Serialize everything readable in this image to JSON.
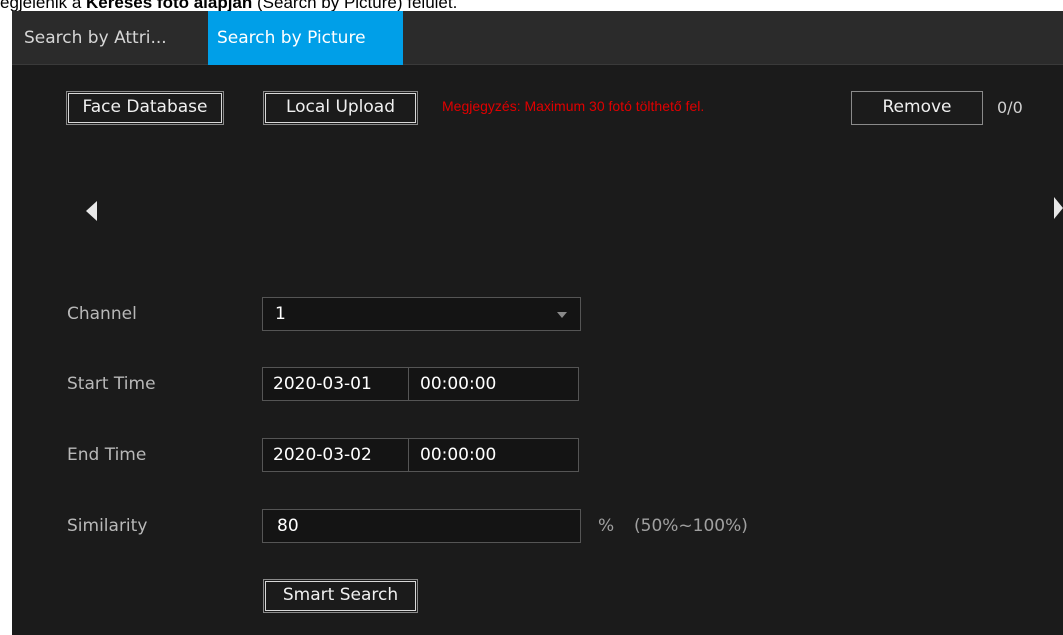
{
  "caption": {
    "prefix": "egjelenik a ",
    "bold": "Keresés fotó alapján",
    "suffix": " (Search by Picture) felület."
  },
  "tabs": [
    {
      "label": "Search by Attri...",
      "active": false
    },
    {
      "label": "Search by Picture",
      "active": true
    }
  ],
  "toolbar": {
    "face_database_label": "Face Database",
    "local_upload_label": "Local Upload",
    "note": "Megjegyzés: Maximum 30 fotó tölthető fel.",
    "remove_label": "Remove",
    "counter": "0/0"
  },
  "form": {
    "channel": {
      "label": "Channel",
      "value": "1"
    },
    "start_time": {
      "label": "Start Time",
      "date": "2020-03-01",
      "time": "00:00:00"
    },
    "end_time": {
      "label": "End Time",
      "date": "2020-03-02",
      "time": "00:00:00"
    },
    "similarity": {
      "label": "Similarity",
      "value": "80",
      "unit": "%",
      "range": "(50%~100%)"
    },
    "smart_search_label": "Smart Search"
  },
  "colors": {
    "accent": "#009fe8",
    "note": "#e00000",
    "panel_bg": "#1b1b1b"
  },
  "icons": {
    "prev": "arrow-left-icon",
    "next": "arrow-right-icon",
    "dropdown": "chevron-down-icon"
  }
}
